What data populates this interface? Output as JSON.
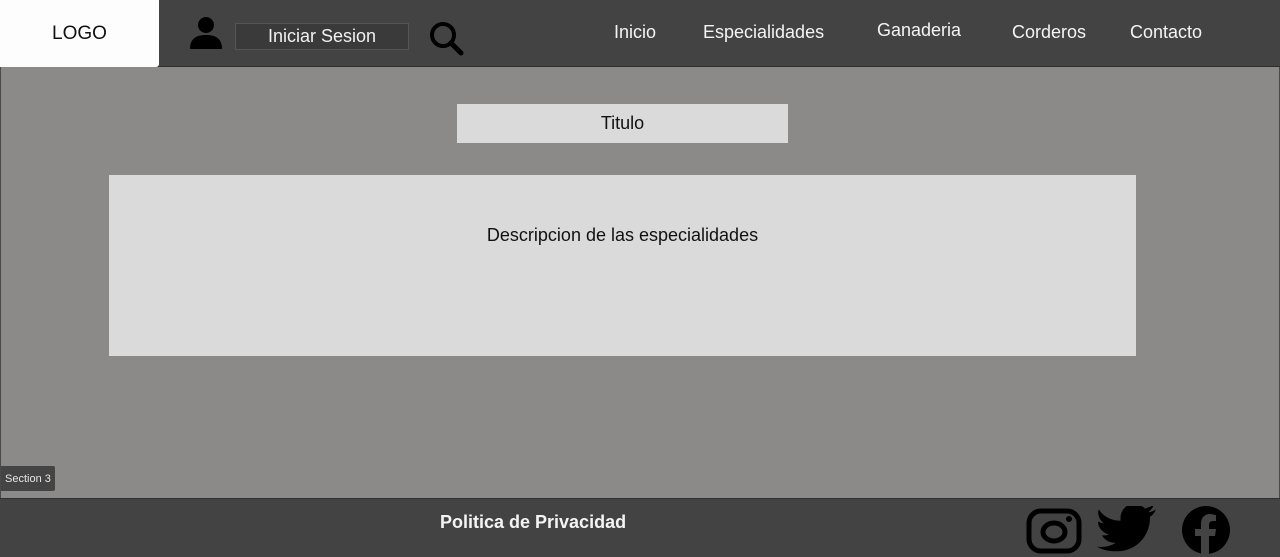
{
  "header": {
    "logo": "LOGO",
    "login_label": "Iniciar Sesion",
    "user_icon": "user-icon",
    "search_icon": "search-icon",
    "nav": [
      "Inicio",
      "Especialidades",
      "Ganaderia",
      "Corderos",
      "Contacto"
    ]
  },
  "main": {
    "title": "Titulo",
    "description": "Descripcion de las especialidades",
    "section_tag": "Section 3"
  },
  "footer": {
    "privacy": "Politica de Privacidad",
    "social_icons": [
      "instagram-icon",
      "twitter-icon",
      "facebook-icon"
    ]
  },
  "colors": {
    "header_bg": "#434343",
    "main_bg": "#8b8a88",
    "box_bg": "#dadada",
    "logo_bg": "#fdfdfd"
  }
}
